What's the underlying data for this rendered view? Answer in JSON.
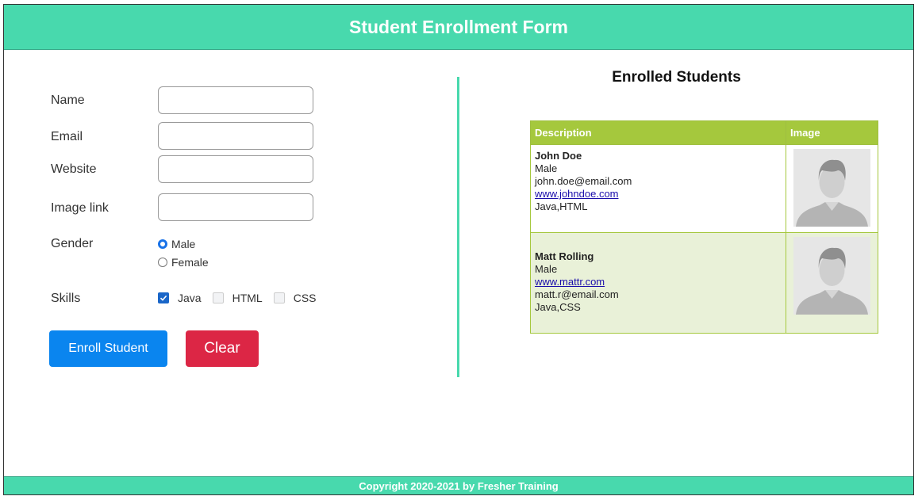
{
  "header": {
    "title": "Student Enrollment Form"
  },
  "form": {
    "name_label": "Name",
    "email_label": "Email",
    "website_label": "Website",
    "image_label": "Image link",
    "gender_label": "Gender",
    "gender_options": [
      "Male",
      "Female"
    ],
    "gender_selected": "Male",
    "skills_label": "Skills",
    "skills": [
      {
        "label": "Java",
        "checked": true
      },
      {
        "label": "HTML",
        "checked": false
      },
      {
        "label": "CSS",
        "checked": false
      }
    ],
    "enroll_label": "Enroll Student",
    "clear_label": "Clear"
  },
  "list": {
    "title": "Enrolled Students",
    "columns": [
      "Description",
      "Image"
    ],
    "students": [
      {
        "name": "John Doe",
        "gender": "Male",
        "line3": "john.doe@email.com",
        "line4": "www.johndoe.com",
        "line4_is_link": true,
        "skills": "Java,HTML",
        "avatar_icon": "person-placeholder-icon"
      },
      {
        "name": "Matt Rolling",
        "gender": "Male",
        "line3": "www.mattr.com",
        "line3_is_link": true,
        "line4": "matt.r@email.com",
        "skills": "Java,CSS",
        "avatar_icon": "person-placeholder-icon"
      }
    ]
  },
  "footer": {
    "text": "Copyright 2020-2021 by Fresher Training"
  },
  "colors": {
    "accent": "#48d9ad",
    "table_header": "#a5c83d",
    "enroll": "#0a85ef",
    "clear": "#dc2645"
  }
}
